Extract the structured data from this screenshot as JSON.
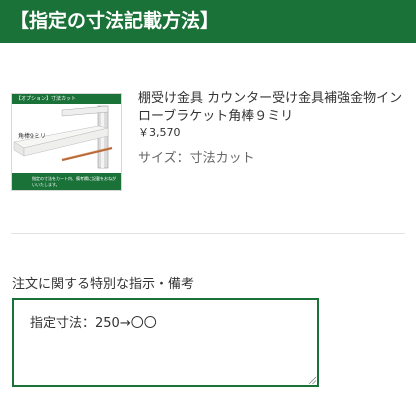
{
  "header": {
    "title": "【指定の寸法記載方法】"
  },
  "product": {
    "image": {
      "band_text": "【オプション】寸法カット",
      "label": "角棒9ミリ",
      "bottom_text": "指定の寸法をカート内、備考欄に記載をおねがいいたします。",
      "icon": "shelf-bracket-image"
    },
    "name": "棚受け金具 カウンター受け金具補強金物インローブラケット角棒９ミリ",
    "price": "￥3,570",
    "option": "サイズ：寸法カット"
  },
  "request": {
    "label": "注文に関する特別な指示・備考",
    "value": "指定寸法：250→〇〇"
  },
  "colors": {
    "brand_green": "#1a7238",
    "text": "#333333",
    "muted": "#666666"
  }
}
